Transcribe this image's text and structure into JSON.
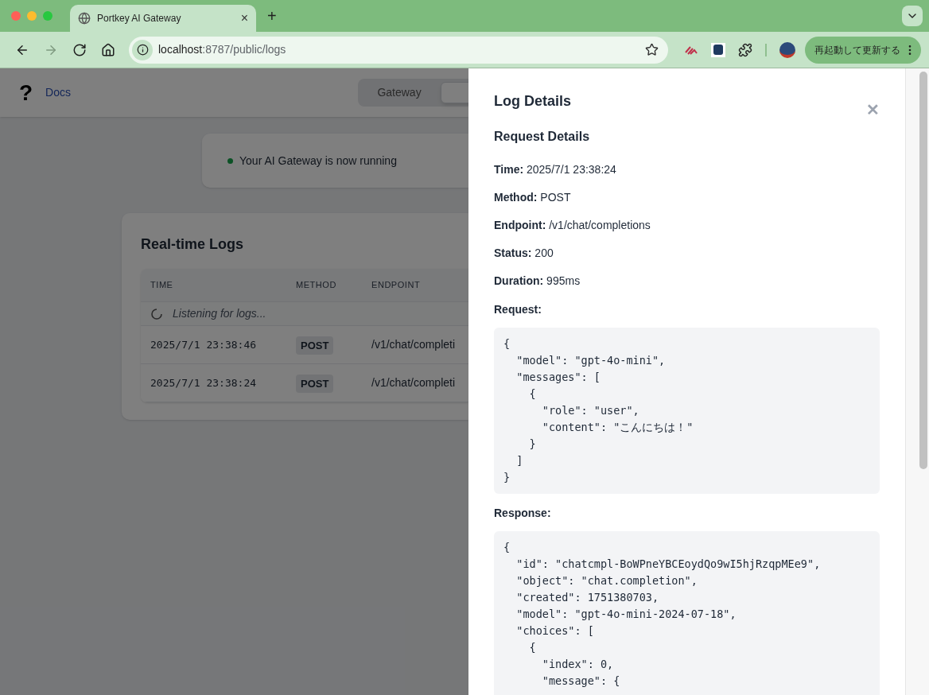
{
  "browser": {
    "tab": {
      "title": "Portkey AI Gateway",
      "close": "×"
    },
    "new_tab": "+",
    "nav": [
      {
        "kind": "back",
        "disabled": false
      },
      {
        "kind": "forward",
        "disabled": true
      },
      {
        "kind": "reload",
        "disabled": false
      },
      {
        "kind": "home",
        "disabled": false
      }
    ],
    "address": {
      "host": "localhost",
      "path": ":8787/public/logs"
    },
    "update_button": {
      "label": "再起動して更新する"
    }
  },
  "page": {
    "header": {
      "help_glyph": "?",
      "docs_link": "Docs",
      "tabs": [
        {
          "label": "Gateway",
          "selected": false
        },
        {
          "selected": true
        }
      ]
    },
    "status": {
      "text": "Your AI Gateway is now running",
      "running": true
    },
    "logs": {
      "title": "Real-time Logs",
      "columns": [
        "TIME",
        "METHOD",
        "ENDPOINT"
      ],
      "listening": "Listening for logs...",
      "rows": [
        {
          "time": "2025/7/1 23:38:46",
          "method": "POST",
          "endpoint": "/v1/chat/completi"
        },
        {
          "time": "2025/7/1 23:38:24",
          "method": "POST",
          "endpoint": "/v1/chat/completi"
        }
      ]
    }
  },
  "panel": {
    "title": "Log Details",
    "close": "✕",
    "section": "Request Details",
    "fields": [
      {
        "label": "Time:",
        "value": "2025/7/1 23:38:24"
      },
      {
        "label": "Method:",
        "value": "POST"
      },
      {
        "label": "Endpoint:",
        "value": "/v1/chat/completions"
      },
      {
        "label": "Status:",
        "value": "200"
      },
      {
        "label": "Duration:",
        "value": "995ms"
      }
    ],
    "request_label": "Request:",
    "request_body": "{\n  \"model\": \"gpt-4o-mini\",\n  \"messages\": [\n    {\n      \"role\": \"user\",\n      \"content\": \"こんにちは！\"\n    }\n  ]\n}",
    "response_label": "Response:",
    "response_body": "{\n  \"id\": \"chatcmpl-BoWPneYBCEoydQo9wI5hjRzqpMEe9\",\n  \"object\": \"chat.completion\",\n  \"created\": 1751380703,\n  \"model\": \"gpt-4o-mini-2024-07-18\",\n  \"choices\": [\n    {\n      \"index\": 0,\n      \"message\": {"
  }
}
